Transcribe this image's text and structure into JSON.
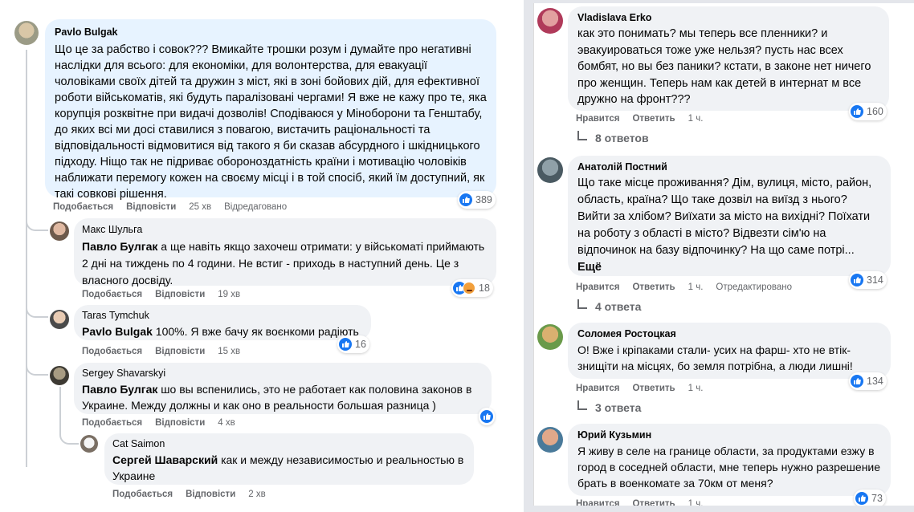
{
  "left": {
    "comments": [
      {
        "author": "Pavlo Bulgak",
        "text": "Що це за рабство і совок??? Вмикайте трошки розум і думайте про негативні наслідки для всього: для економіки, для волонтерства, для евакуації чоловіками своїх дітей та дружин з міст, які в зоні бойових дій, для ефективної роботи військоматів, які будуть паралізовані чергами! Я вже не кажу про те, яка корупція розквітне при видачі дозволів! Сподіваюся у Міноборони та Генштабу, до яких всі ми досі ставилися з повагою, вистачить раціональності та відповідальності відмовитися від такого я би сказав абсурдного і шкідницького підходу. Ніщо так не підриває обороноздатність країни і мотивацію чоловіків наближати перемогу кожен на своєму місці і в той спосіб, який їм доступний, як такі совкові рішення.",
        "like": "Подобається",
        "reply": "Відповісти",
        "time": "25 хв",
        "edited": "Відредаговано",
        "reactions": "389"
      },
      {
        "author": "Макс Шульга",
        "mention": "Павло Булгак",
        "text": " а ще навіть якщо захочеш отримати: у військоматі приймають 2 дні на тиждень по 4 години. Не встиг - приходь в наступний день. Це з власного досвіду.",
        "like": "Подобається",
        "reply": "Відповісти",
        "time": "19 хв",
        "reactions": "18"
      },
      {
        "author": "Taras Tymchuk",
        "mention": "Pavlo Bulgak",
        "text": " 100%. Я вже бачу як воєнкоми радіють",
        "like": "Подобається",
        "reply": "Відповісти",
        "time": "15 хв",
        "reactions": "16"
      },
      {
        "author": "Sergey Shavarskyi",
        "mention": "Павло Булгак",
        "text": " шо вы вспенились, это не работает как половина законов в Украине. Между должны и как оно в реальности большая разница )",
        "like": "Подобається",
        "reply": "Відповісти",
        "time": "4 хв"
      },
      {
        "author": "Cat Saimon",
        "mention": "Сергей Шаварский",
        "text": " как и между независимостью и реальностью в Украине",
        "like": "Подобається",
        "reply": "Відповісти",
        "time": "2 хв"
      }
    ]
  },
  "right": {
    "comments": [
      {
        "author": "Vladislava Erko",
        "text": "как это понимать? мы теперь все пленники? и эвакуироваться тоже уже нельзя? пусть нас всех бомбят, но вы без паники? кстати, в законе нет ничего про женщин. Теперь нам как детей в интернат м все дружно на фронт???",
        "like": "Нравится",
        "reply": "Ответить",
        "time": "1 ч.",
        "reactions": "160",
        "replies": "8 ответов"
      },
      {
        "author": "Анатолій Постний",
        "text": "Що таке місце проживання? Дім, вулиця, місто, район, область, країна? Що таке дозвіл на виїзд з нього? Вийти за хлібом? Виїхати за місто на вихідні? Поїхати на роботу з області в місто? Відвезти сім'ю на відпочинок на базу відпочинку? На що саме потрі... ",
        "more": "Ещё",
        "like": "Нравится",
        "reply": "Ответить",
        "time": "1 ч.",
        "edited": "Отредактировано",
        "reactions": "314",
        "replies": "4 ответа"
      },
      {
        "author": "Соломея Ростоцкая",
        "text": "О! Вже і кріпаками стали- усих на фарш- хто не втік- знищіти на місцях, бо земля потрібна, а люди лишні!",
        "like": "Нравится",
        "reply": "Ответить",
        "time": "1 ч.",
        "reactions": "134",
        "replies": "3 ответа"
      },
      {
        "author": "Юрий Кузьмин",
        "text": "Я живу в селе на границе области, за продуктами езжу в город в соседней области, мне теперь нужно разрешение брать в военкомате за 70км от меня?",
        "like": "Нравится",
        "reply": "Ответить",
        "time": "1 ч.",
        "reactions": "73"
      }
    ]
  }
}
